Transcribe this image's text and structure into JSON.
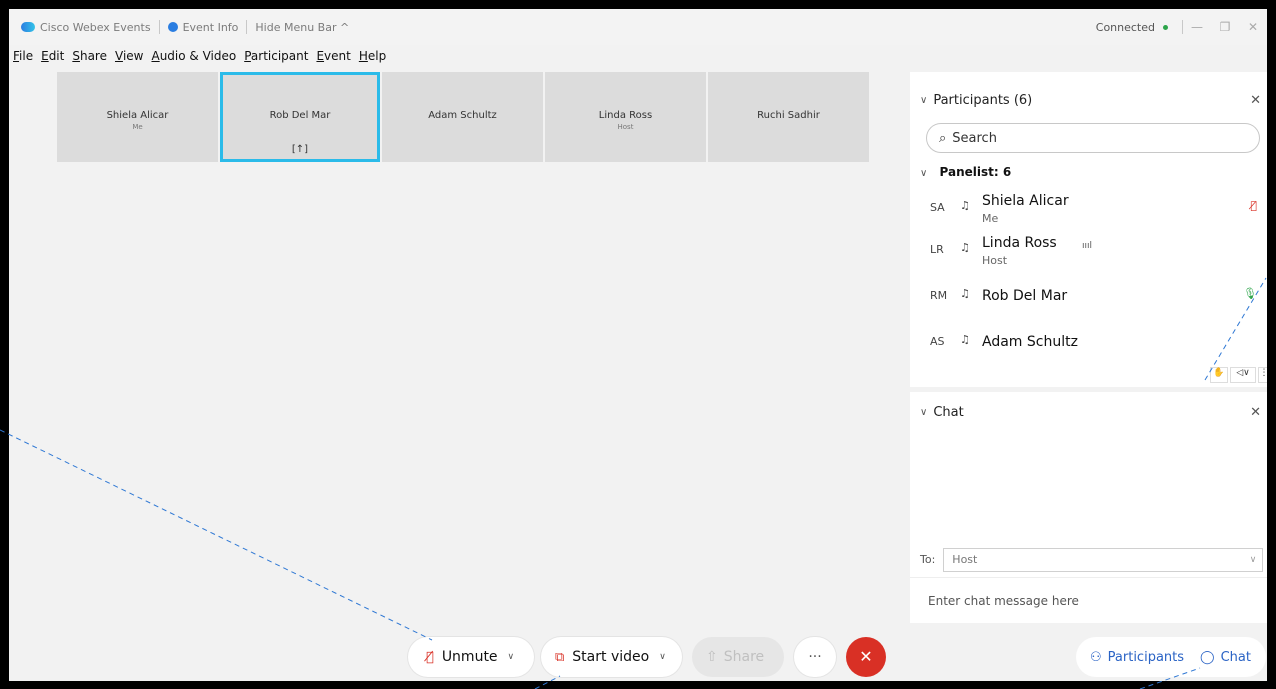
{
  "titlebar": {
    "app_name": "Cisco Webex Events",
    "event_info": "Event Info",
    "hide_menu": "Hide Menu Bar ^",
    "status": "Connected"
  },
  "menu": [
    "File",
    "Edit",
    "Share",
    "View",
    "Audio & Video",
    "Participant",
    "Event",
    "Help"
  ],
  "tiles": [
    {
      "name": "Shiela Alicar",
      "sub": "Me"
    },
    {
      "name": "Rob Del Mar",
      "sub": ""
    },
    {
      "name": "Adam Schultz",
      "sub": ""
    },
    {
      "name": "Linda Ross",
      "sub": "Host"
    },
    {
      "name": "Ruchi Sadhir",
      "sub": ""
    }
  ],
  "participants_panel": {
    "title": "Participants (6)",
    "search_placeholder": "Search",
    "group": "Panelist: 6",
    "rows": [
      {
        "initials": "SA",
        "name": "Shiela Alicar",
        "role": "Me"
      },
      {
        "initials": "LR",
        "name": "Linda Ross",
        "role": "Host"
      },
      {
        "initials": "RM",
        "name": "Rob Del Mar",
        "role": ""
      },
      {
        "initials": "AS",
        "name": "Adam Schultz",
        "role": ""
      }
    ]
  },
  "chat_panel": {
    "title": "Chat",
    "to_label": "To:",
    "to_value": "Host",
    "input_placeholder": "Enter chat message here"
  },
  "controls": {
    "unmute": "Unmute",
    "start_video": "Start video",
    "share": "Share",
    "more": "···",
    "participants": "Participants",
    "chat": "Chat"
  },
  "colors": {
    "accent": "#2bbbe9",
    "end": "#d93025",
    "link": "#2a63c5"
  }
}
